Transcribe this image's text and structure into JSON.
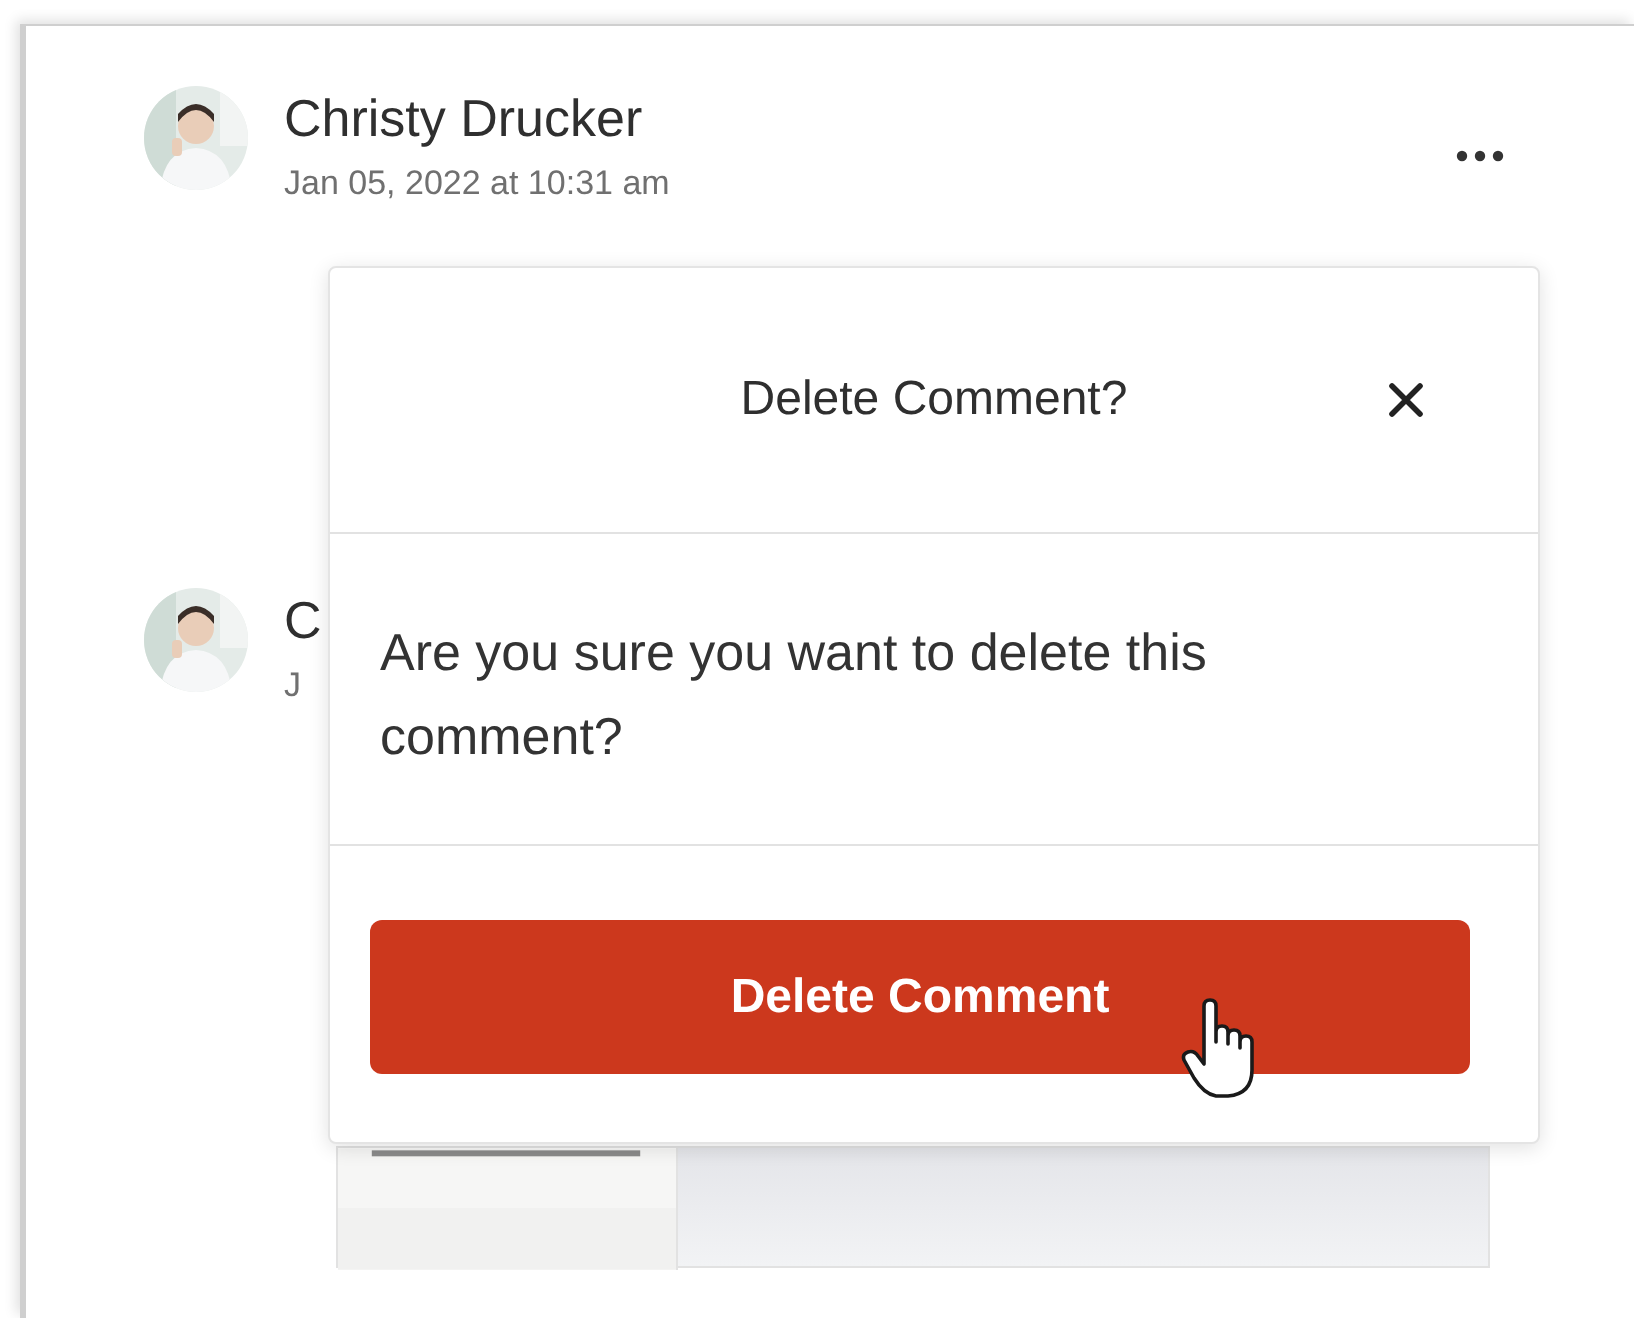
{
  "comments": [
    {
      "author": "Christy Drucker",
      "timestamp": "Jan 05, 2022 at 10:31 am",
      "has_menu": true
    },
    {
      "author": "C",
      "timestamp": "J"
    }
  ],
  "dialog": {
    "title": "Delete Comment?",
    "message": "Are you sure you want to delete this comment?",
    "confirm_button": "Delete Comment"
  }
}
